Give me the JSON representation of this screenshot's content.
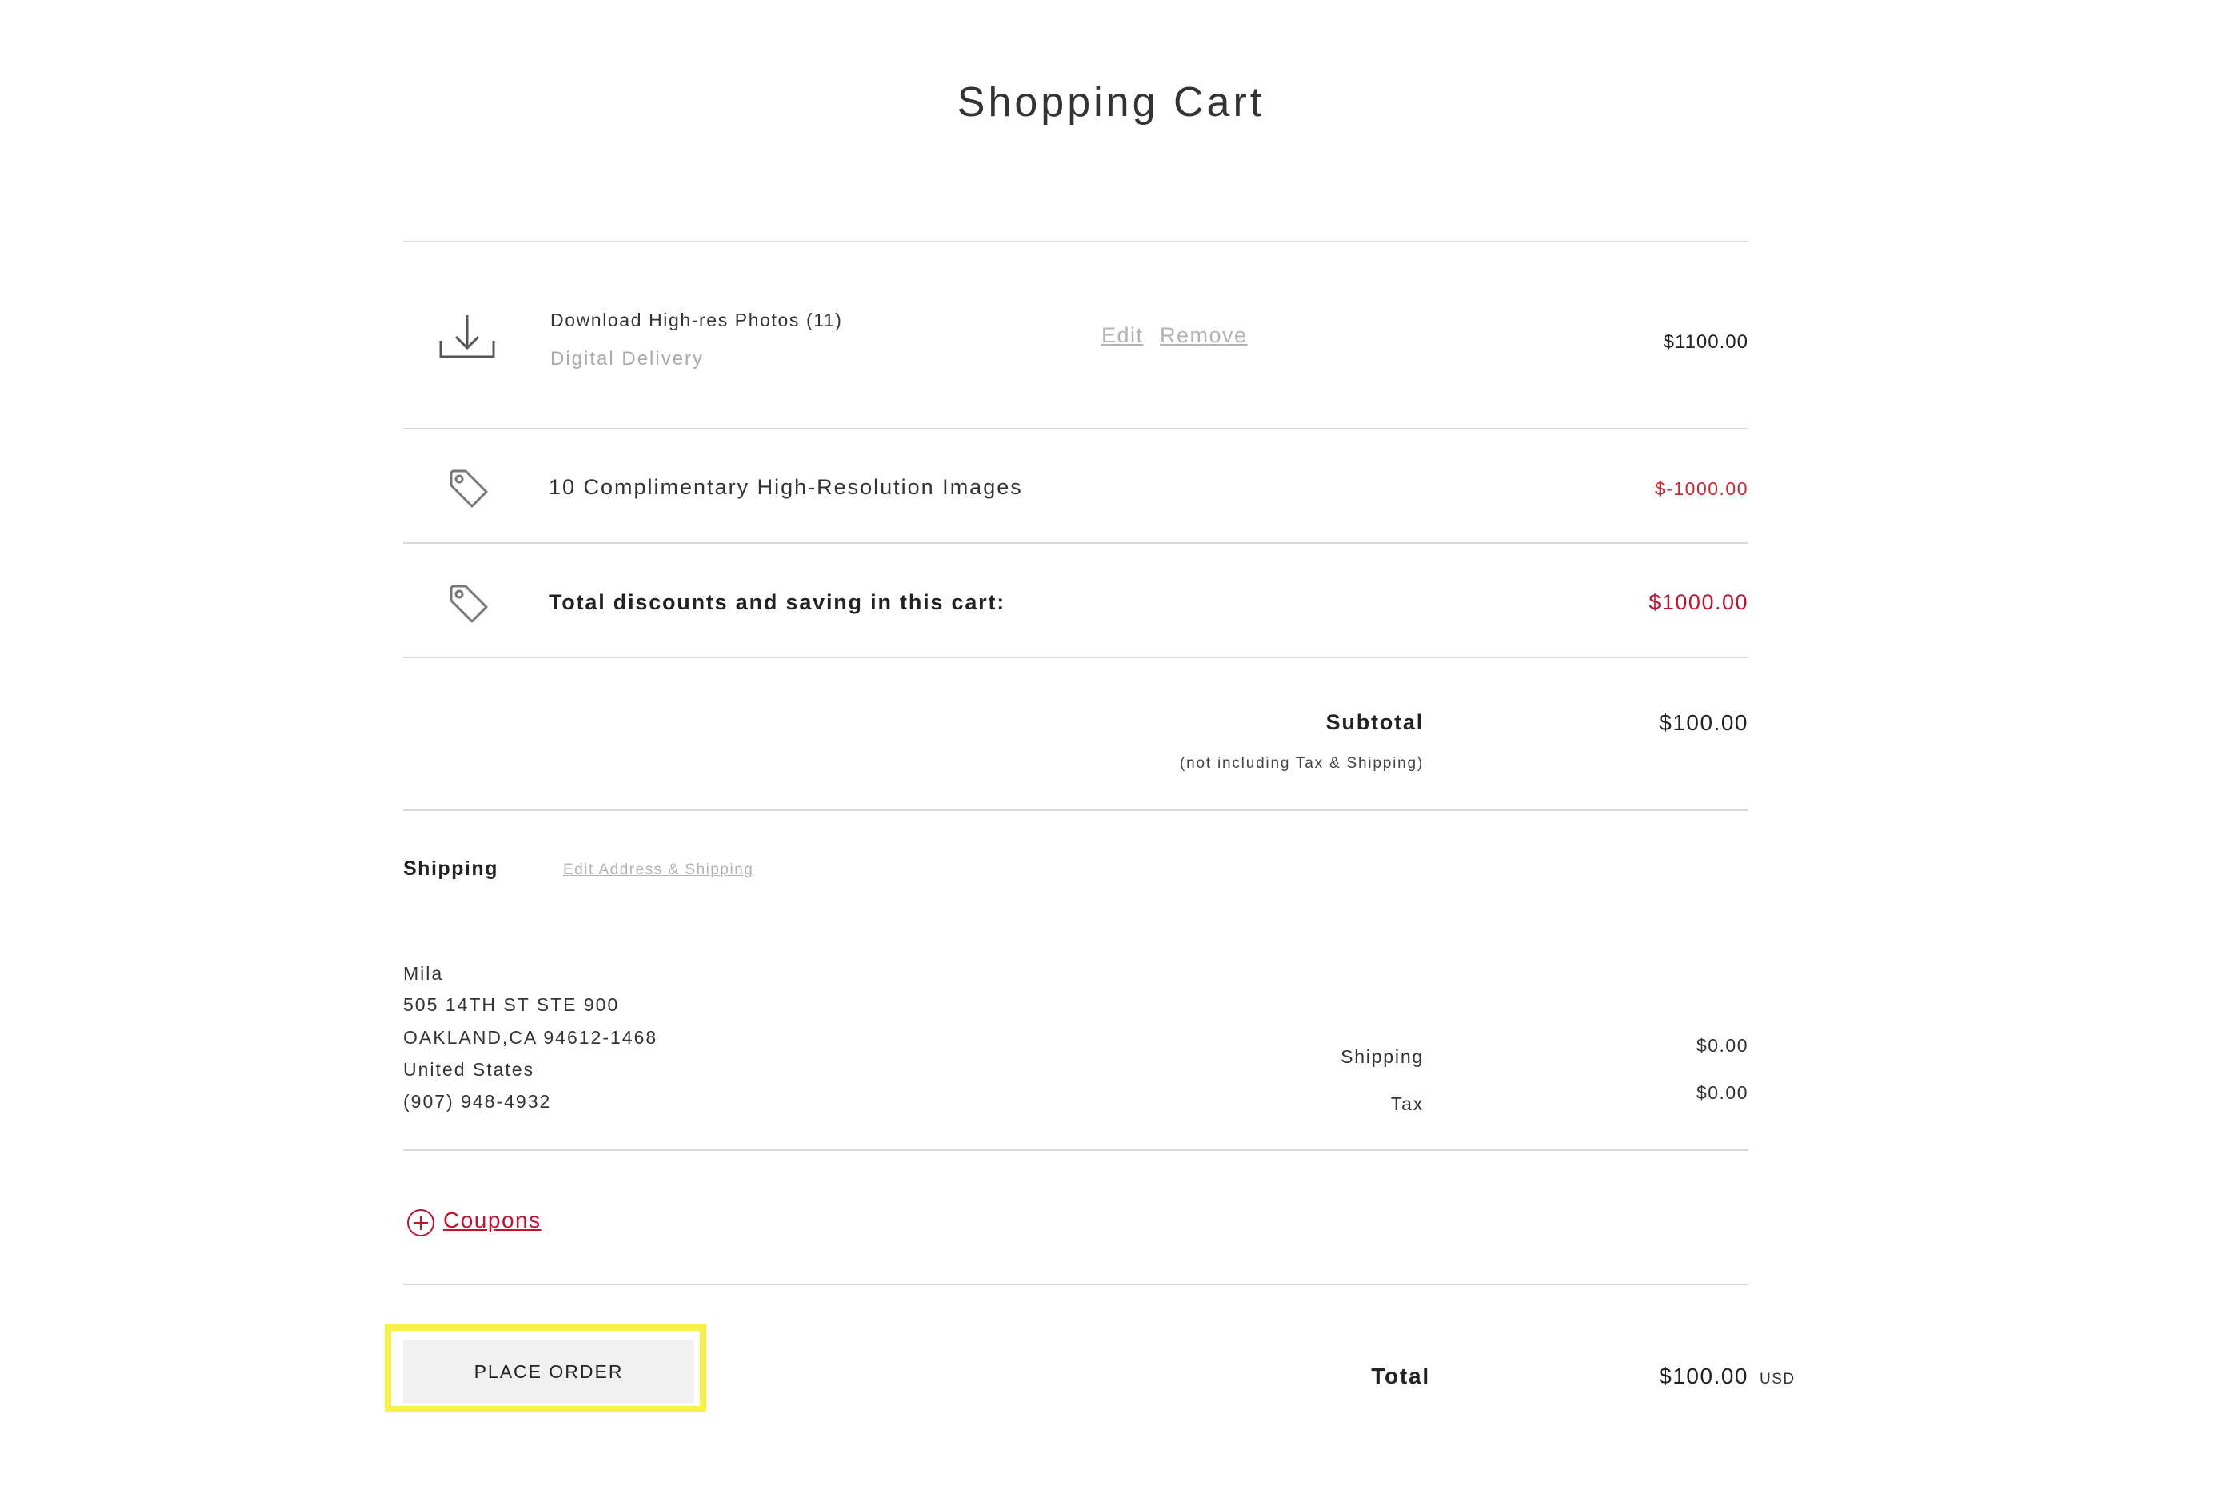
{
  "page": {
    "title": "Shopping Cart"
  },
  "cart": {
    "item": {
      "title": "Download High-res Photos (11)",
      "subtitle": "Digital Delivery",
      "edit_label": "Edit",
      "remove_label": "Remove",
      "price": "$1100.00",
      "icon": "download-icon"
    },
    "promotion": {
      "label": "10 Complimentary High-Resolution Images",
      "amount": "$-1000.00",
      "icon": "tag-icon"
    },
    "discount_total": {
      "label": "Total discounts and saving in this cart:",
      "amount": "$1000.00",
      "icon": "tag-icon"
    },
    "subtotal": {
      "label": "Subtotal",
      "note": "(not including Tax & Shipping)",
      "amount": "$100.00"
    }
  },
  "shipping": {
    "heading": "Shipping",
    "edit_link": "Edit Address & Shipping",
    "address": {
      "name": "Mila",
      "line1": "505 14TH ST STE 900",
      "line2": "OAKLAND,CA 94612-1468",
      "country": "United States",
      "phone": "(907) 948-4932"
    },
    "shipping_label": "Shipping",
    "shipping_amount": "$0.00",
    "tax_label": "Tax",
    "tax_amount": "$0.00"
  },
  "coupons": {
    "label": "Coupons",
    "icon": "plus-circle-icon"
  },
  "order": {
    "button_label": "PLACE ORDER",
    "total_label": "Total",
    "total_amount": "$100.00",
    "currency": "USD"
  },
  "colors": {
    "accent_red": "#c8102e",
    "highlight": "#f7f24a",
    "muted": "#b3b3b3",
    "button_bg": "#f0f0f0"
  }
}
